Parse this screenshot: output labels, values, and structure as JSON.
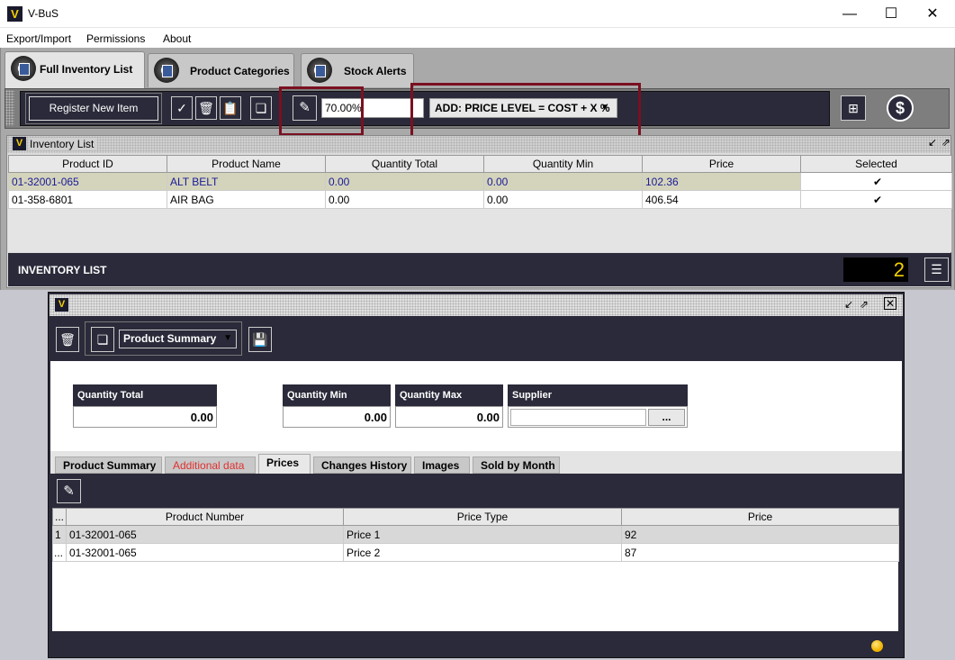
{
  "window": {
    "title": "V-BuS",
    "logo": "V"
  },
  "menu": {
    "items": [
      "Export/Import",
      "Permissions",
      "About"
    ]
  },
  "tabs": [
    {
      "label": "Full Inventory List",
      "active": true
    },
    {
      "label": "Product Categories",
      "active": false
    },
    {
      "label": "Stock Alerts",
      "active": false
    }
  ],
  "toolbar": {
    "register_label": "Register New Item",
    "percent_value": "70.00%",
    "price_level": "ADD: PRICE LEVEL = COST + X %"
  },
  "inventory": {
    "title": "Inventory List",
    "columns": [
      "Product ID",
      "Product Name",
      "Quantity Total",
      "Quantity Min",
      "Price",
      "Selected"
    ],
    "rows": [
      {
        "id": "01-32001-065",
        "name": "ALT BELT",
        "qty_total": "0.00",
        "qty_min": "0.00",
        "price": "102.36",
        "selected": "✔"
      },
      {
        "id": "01-358-6801",
        "name": "AIR BAG",
        "qty_total": "0.00",
        "qty_min": "0.00",
        "price": "406.54",
        "selected": "✔"
      }
    ],
    "footer_label": "INVENTORY LIST",
    "count": "2"
  },
  "product": {
    "view_select": "Product Summary",
    "fields": {
      "qty_total_label": "Quantity Total",
      "qty_total": "0.00",
      "qty_min_label": "Quantity Min",
      "qty_min": "0.00",
      "qty_max_label": "Quantity Max",
      "qty_max": "0.00",
      "supplier_label": "Supplier",
      "supplier": "",
      "supplier_browse": "..."
    },
    "subtabs": [
      "Product Summary",
      "Additional data",
      "Prices",
      "Changes History",
      "Images",
      "Sold by Month"
    ],
    "prices": {
      "columns": [
        "...",
        "Product Number",
        "Price Type",
        "Price"
      ],
      "rows": [
        {
          "idx": "1",
          "number": "01-32001-065",
          "type": "Price 1",
          "price": "92"
        },
        {
          "idx": "...",
          "number": "01-32001-065",
          "type": "Price 2",
          "price": "87"
        }
      ]
    }
  },
  "colors": {
    "accent_dark": "#2a2a3a",
    "highlight": "#7a1020",
    "count_text": "#f5d000",
    "additional_tab": "#e03030"
  }
}
